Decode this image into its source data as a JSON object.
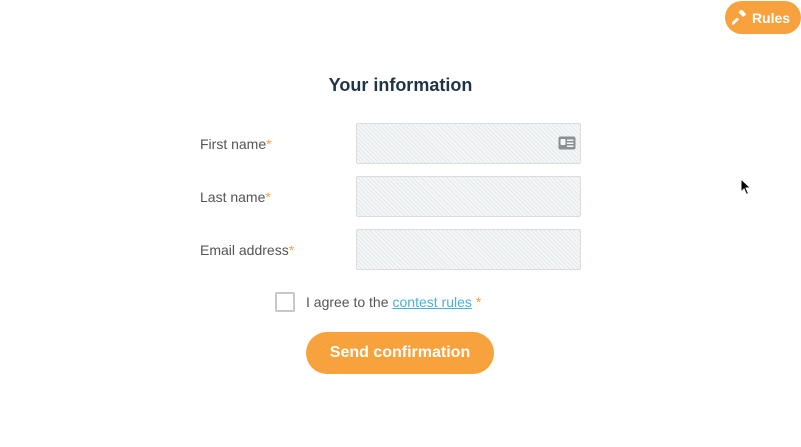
{
  "rules_button": {
    "label": "Rules",
    "icon": "hammer-icon"
  },
  "form": {
    "title": "Your information",
    "fields": [
      {
        "label": "First name",
        "required_mark": "*",
        "value": "",
        "placeholder": "",
        "icon": "contact-card-icon"
      },
      {
        "label": "Last name",
        "required_mark": "*",
        "value": "",
        "placeholder": ""
      },
      {
        "label": "Email address",
        "required_mark": "*",
        "value": "",
        "placeholder": ""
      }
    ],
    "agree": {
      "text": "I agree to the",
      "link_text": "contest rules",
      "required_mark": "*",
      "checked": false
    },
    "submit_label": "Send confirmation"
  },
  "colors": {
    "accent": "#f7a23c",
    "title": "#1f3447",
    "link": "#4bb0d6",
    "text": "#555555"
  }
}
